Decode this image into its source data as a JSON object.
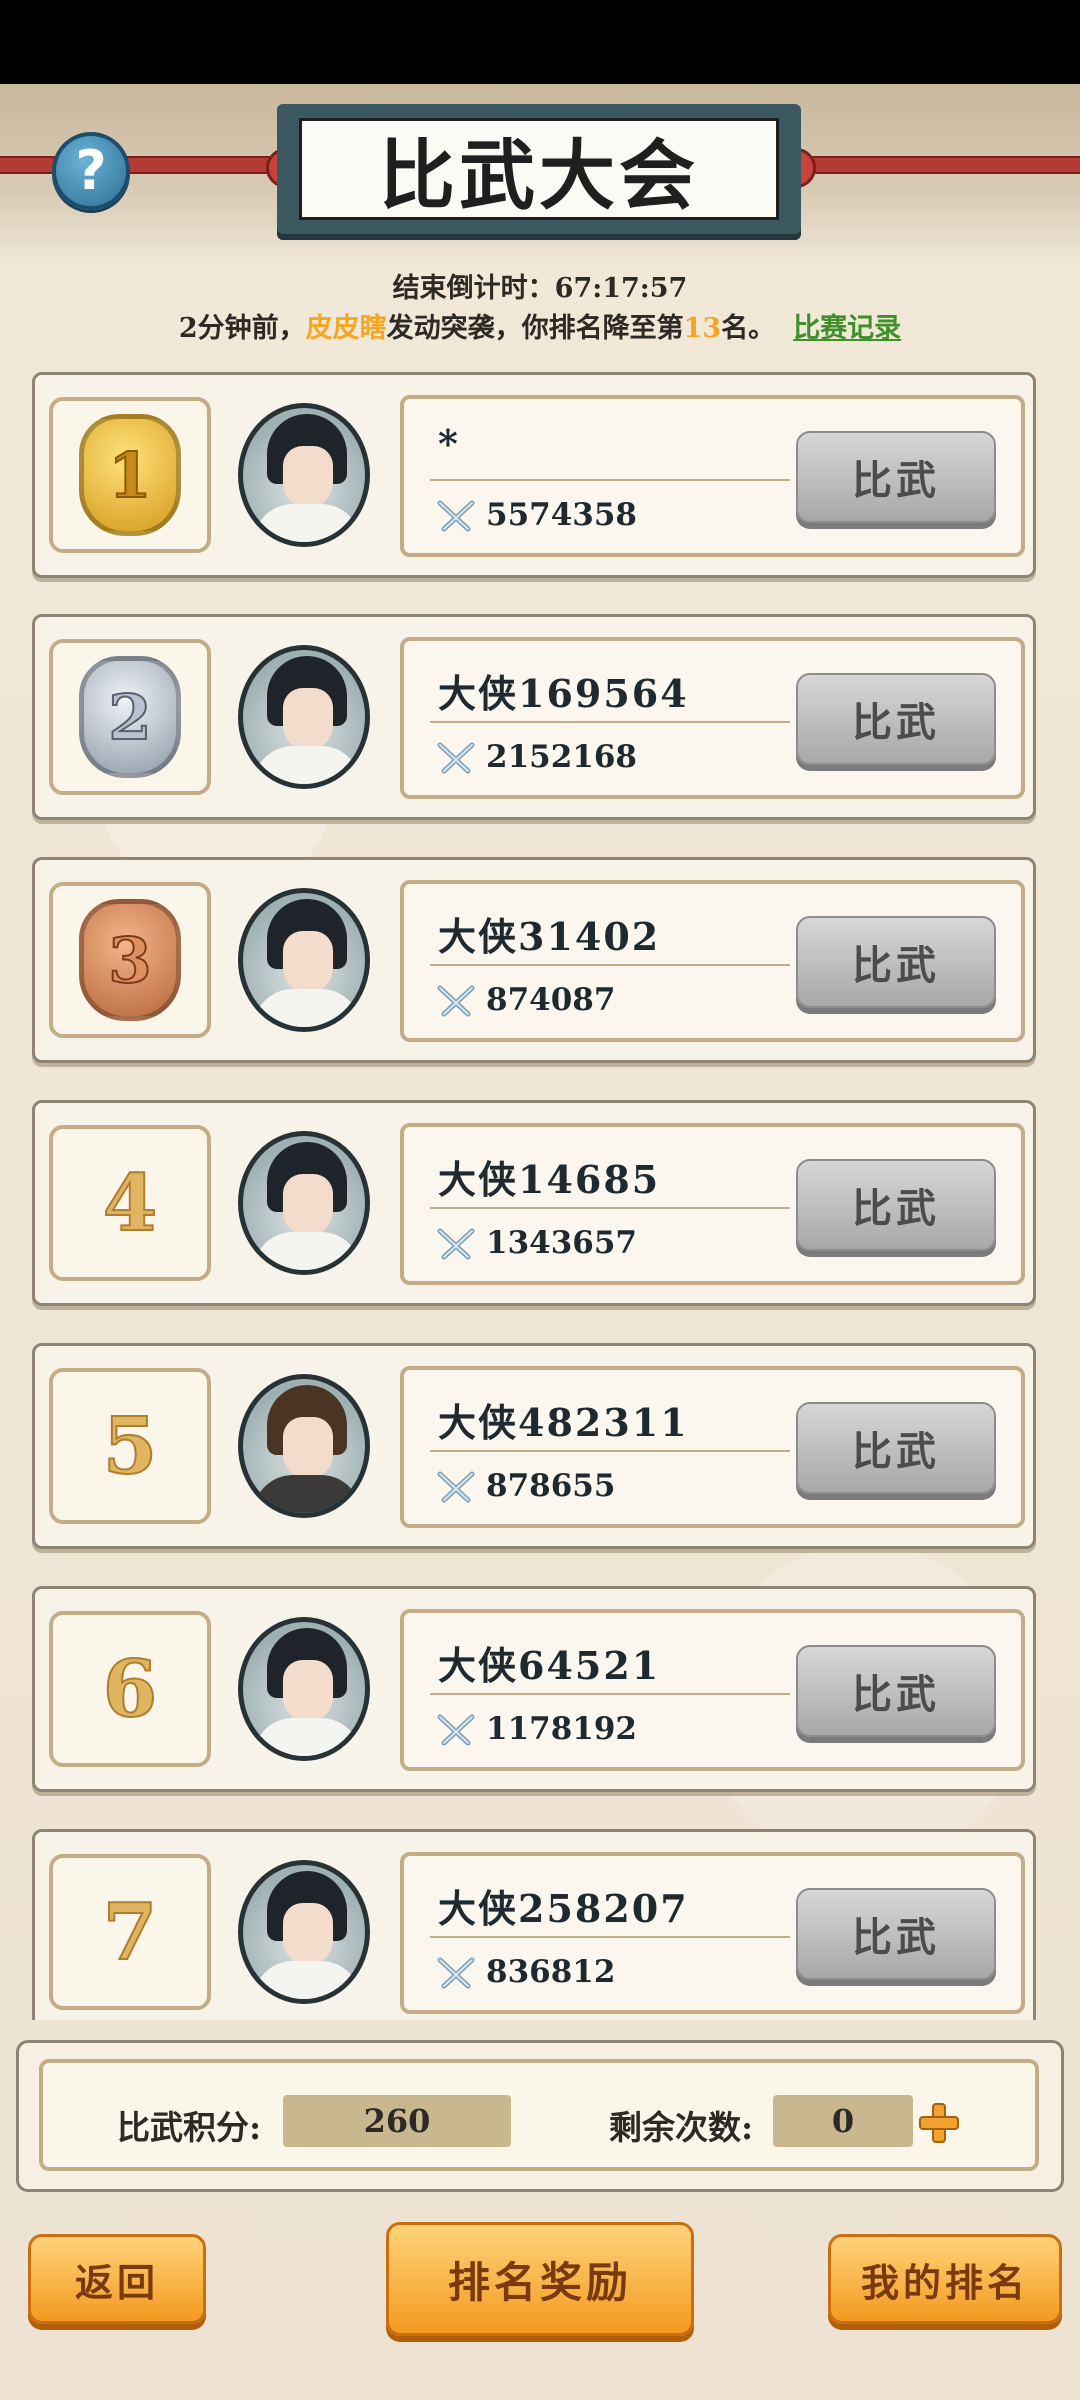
{
  "header": {
    "title": "比武大会",
    "help_symbol": "?"
  },
  "info": {
    "countdown_label": "结束倒计时：",
    "countdown_value": "67:17:57",
    "news_prefix": "2分钟前，",
    "news_attacker": "皮皮瞎",
    "news_middle": "发动突袭，你排名降至第",
    "news_rank": "13",
    "news_suffix": "名。",
    "record_link": "比赛记录"
  },
  "rankings": [
    {
      "rank": "1",
      "name": "*",
      "power": "5574358",
      "button": "比武"
    },
    {
      "rank": "2",
      "name": "大侠169564",
      "power": "2152168",
      "button": "比武"
    },
    {
      "rank": "3",
      "name": "大侠31402",
      "power": "874087",
      "button": "比武"
    },
    {
      "rank": "4",
      "name": "大侠14685",
      "power": "1343657",
      "button": "比武"
    },
    {
      "rank": "5",
      "name": "大侠482311",
      "power": "878655",
      "button": "比武"
    },
    {
      "rank": "6",
      "name": "大侠64521",
      "power": "1178192",
      "button": "比武"
    },
    {
      "rank": "7",
      "name": "大侠258207",
      "power": "836812",
      "button": "比武"
    }
  ],
  "stats": {
    "score_label": "比武积分:",
    "score_value": "260",
    "remaining_label": "剩余次数:",
    "remaining_value": "0"
  },
  "footer": {
    "back": "返回",
    "rewards": "排名奖励",
    "my_rank": "我的排名"
  },
  "colors": {
    "gold": "#d49a1e",
    "silver": "#8e9aa8",
    "bronze": "#b8673c",
    "accent_orange": "#f5a623",
    "link_green": "#3f8f2a"
  },
  "icons": {
    "help": "question-icon",
    "power": "crossed-swords-icon",
    "add": "plus-icon"
  }
}
